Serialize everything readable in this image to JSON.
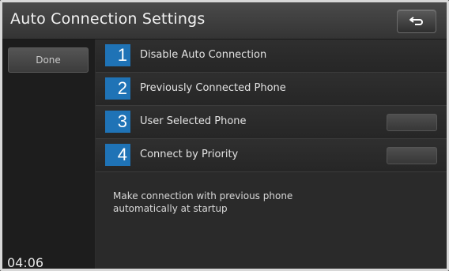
{
  "header": {
    "title": "Auto Connection Settings",
    "back_icon": "back-arrow-icon"
  },
  "sidebar": {
    "done_label": "Done",
    "clock": "04:06"
  },
  "options": [
    {
      "number": "1",
      "label": "Disable Auto Connection"
    },
    {
      "number": "2",
      "label": "Previously Connected Phone"
    },
    {
      "number": "3",
      "label": "User Selected Phone"
    },
    {
      "number": "4",
      "label": "Connect by Priority"
    }
  ],
  "description": "Make connection with previous phone automatically at startup",
  "colors": {
    "badge": "#1f73b6",
    "background": "#262626"
  }
}
